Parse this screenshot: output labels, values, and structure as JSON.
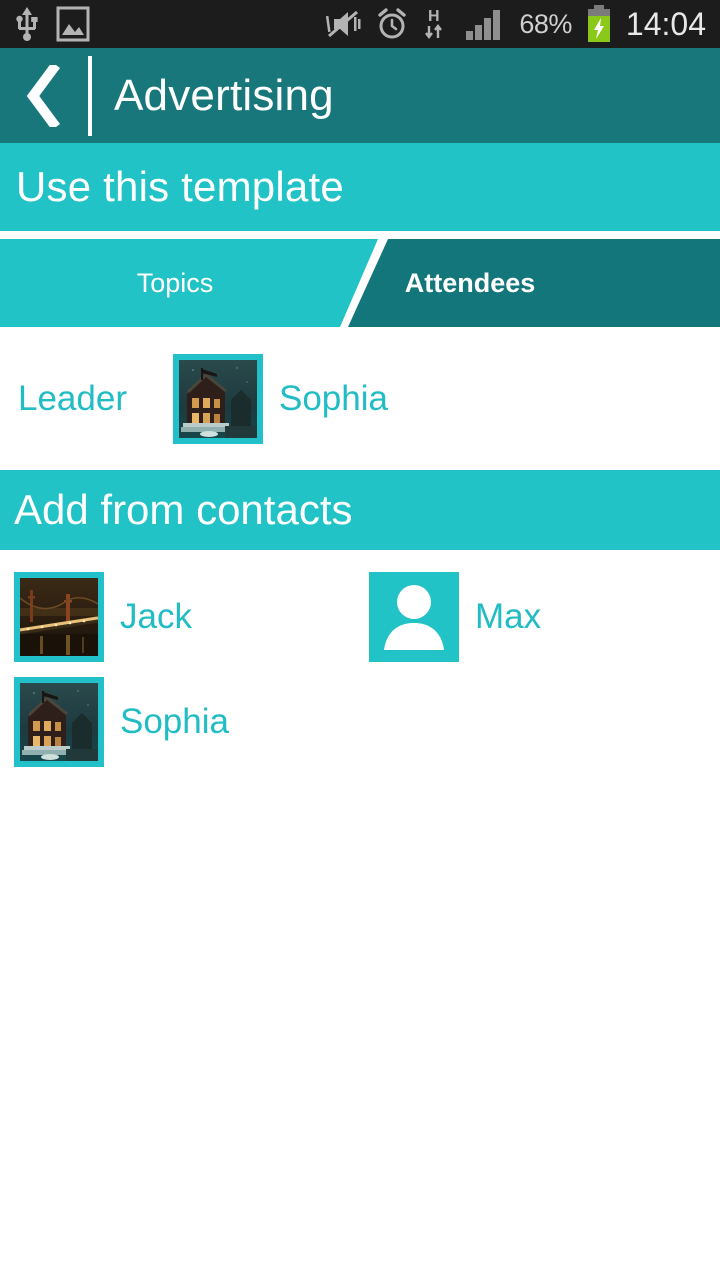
{
  "statusbar": {
    "left_icons": [
      "usb-icon",
      "image-icon"
    ],
    "right_icons": [
      "mute-vibrate-icon",
      "alarm-icon",
      "hspa-data-icon",
      "signal-bars-icon"
    ],
    "battery_percent": "68%",
    "battery_state": "charging",
    "clock": "14:04",
    "background": "#1c1c1c",
    "icon_color": "#b3b3b3"
  },
  "header": {
    "back_label": "back-chevron",
    "title": "Advertising",
    "background": "#18777a"
  },
  "banner": {
    "label": "Use this template",
    "background": "#22c3c6"
  },
  "tabs": {
    "items": [
      {
        "label": "Topics",
        "active": false,
        "background": "#22c3c6"
      },
      {
        "label": "Attendees",
        "active": true,
        "background": "#13767b"
      }
    ]
  },
  "leader": {
    "label": "Leader",
    "name": "Sophia",
    "avatar": "photo-house-night"
  },
  "contacts_section": {
    "title": "Add from contacts",
    "items": [
      {
        "name": "Jack",
        "avatar": "photo-bridge-night"
      },
      {
        "name": "Max",
        "avatar": "default-person-icon"
      },
      {
        "name": "Sophia",
        "avatar": "photo-house-night"
      }
    ]
  },
  "colors": {
    "accent_cyan": "#22c3c6",
    "text_cyan": "#22bcc4",
    "header_teal": "#18777a",
    "active_tab_teal": "#13767b",
    "page_background": "#ffffff"
  }
}
